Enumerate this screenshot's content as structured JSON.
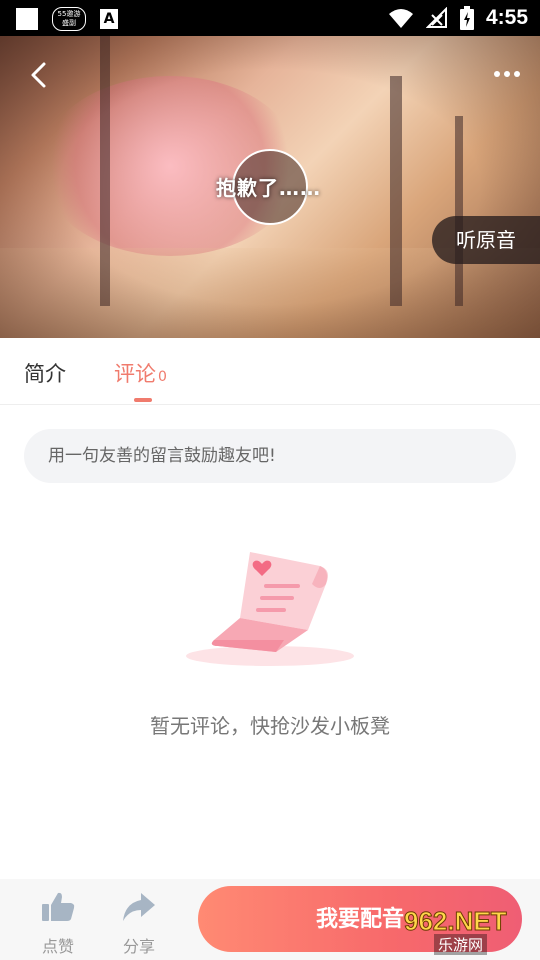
{
  "status_bar": {
    "time": "4:55",
    "badge_text": "55邀游\n盛副",
    "a_icon": "A",
    "icons": [
      "wifi-icon",
      "no-signal-icon",
      "battery-icon"
    ]
  },
  "hero": {
    "title_on_disc": "抱歉了……",
    "original_sound_button": "听原音",
    "icons": {
      "back": "back-arrow-icon",
      "more": "more-dots-icon"
    }
  },
  "tabs": [
    {
      "label": "简介",
      "active": false
    },
    {
      "label": "评论",
      "count": "0",
      "active": true
    }
  ],
  "comment_input": {
    "placeholder": "用一句友善的留言鼓励趣友吧!",
    "value": ""
  },
  "empty_state": {
    "message": "暂无评论，快抢沙发小板凳",
    "icon": "empty-letter-icon"
  },
  "bottom_bar": {
    "like_label": "点赞",
    "share_label": "分享",
    "dub_button": "我要配音"
  },
  "watermark": {
    "top": "962.NET",
    "bottom": "乐游网"
  },
  "colors": {
    "accent": "#f07b6d",
    "dub_gradient_start": "#ff8a73",
    "dub_gradient_end": "#ef5e74",
    "input_bg": "#f3f4f6"
  }
}
